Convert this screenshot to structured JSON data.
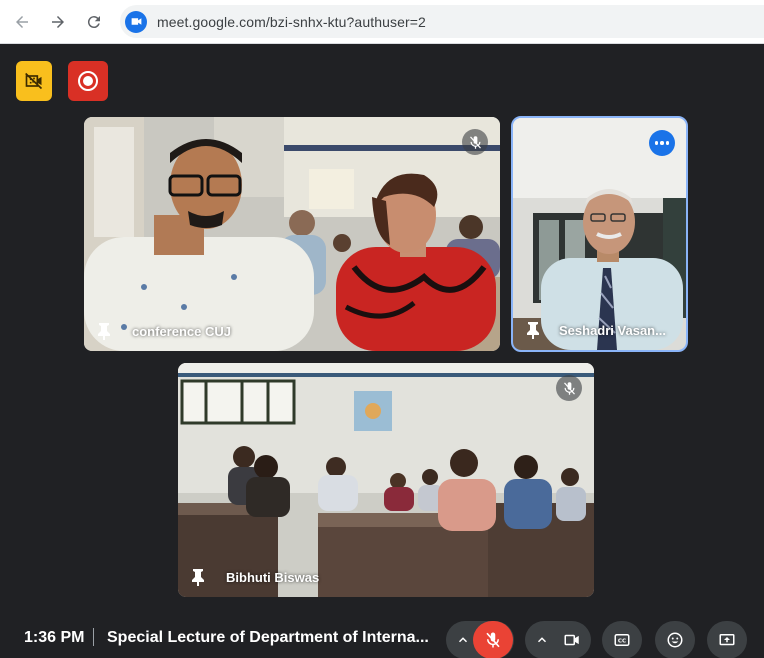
{
  "browser": {
    "url": "meet.google.com/bzi-snhx-ktu?authuser=2",
    "icons": {
      "back": "arrow-left-icon",
      "forward": "arrow-right-icon",
      "reload": "reload-icon",
      "site": "google-meet-icon"
    }
  },
  "indicators": {
    "layout_icon": "camera-off-icon",
    "record_icon": "recording-icon",
    "colors": {
      "layout": "#f9bf1d",
      "record": "#d93025"
    }
  },
  "tiles": [
    {
      "name": "conference CUJ",
      "pinned": false,
      "muted": true
    },
    {
      "name": "Seshadri Vasan...",
      "pinned": false,
      "active_speaker": true,
      "has_more_menu": true
    },
    {
      "name": "Bibhuti Biswas",
      "pinned": false,
      "muted": true
    }
  ],
  "bottom_bar": {
    "time": "1:36 PM",
    "separator": "|",
    "meeting_title": "Special Lecture of Department of Interna...",
    "controls": [
      {
        "name": "microphone",
        "state": "off",
        "icon": "mic-off-icon"
      },
      {
        "name": "camera",
        "state": "on",
        "icon": "videocam-icon"
      },
      {
        "name": "captions",
        "icon": "closed-captions-icon"
      },
      {
        "name": "reactions",
        "icon": "emoji-icon"
      },
      {
        "name": "present",
        "icon": "present-screen-icon"
      }
    ],
    "colors": {
      "mic_off": "#ea4335",
      "control_bg": "#3c4043",
      "speaker_outline": "#8ab4f8"
    }
  }
}
